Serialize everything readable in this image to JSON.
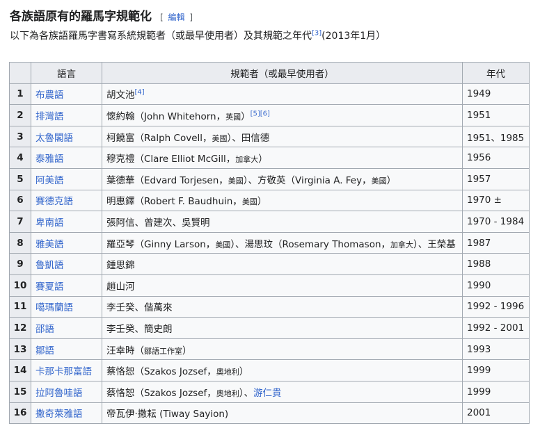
{
  "heading": {
    "title": "各族語原有的羅馬字規範化",
    "edit_open": "[",
    "edit_label": "編輯",
    "edit_close": "]"
  },
  "intro": {
    "text_before": "以下為各族語羅馬字書寫系統規範者（或最早使用者）及其規範之年代",
    "ref": "[3]",
    "text_after": "(2013年1月）"
  },
  "table": {
    "headers": {
      "num": "",
      "language": "語言",
      "standardizer": "規範者（或最早使用者）",
      "year": "年代"
    },
    "rows": [
      {
        "num": "1",
        "language": "布農語",
        "standardizer": [
          {
            "t": "胡文池"
          },
          {
            "ref": "[4]"
          }
        ],
        "year": "1949"
      },
      {
        "num": "2",
        "language": "排灣語",
        "standardizer": [
          {
            "t": "懷約翰（John Whitehorn，"
          },
          {
            "s": "英國"
          },
          {
            "t": "）"
          },
          {
            "ref": "[5]"
          },
          {
            "ref": "[6]"
          }
        ],
        "year": "1951"
      },
      {
        "num": "3",
        "language": "太魯閣語",
        "standardizer": [
          {
            "t": "柯饒富（Ralph Covell，"
          },
          {
            "s": "美國"
          },
          {
            "t": "）、田信德"
          }
        ],
        "year": "1951、1985"
      },
      {
        "num": "4",
        "language": "泰雅語",
        "standardizer": [
          {
            "t": "穆克禮（Clare Elliot McGill，"
          },
          {
            "s": "加拿大"
          },
          {
            "t": "）"
          }
        ],
        "year": "1956"
      },
      {
        "num": "5",
        "language": "阿美語",
        "standardizer": [
          {
            "t": "葉德華（Edvard Torjesen，"
          },
          {
            "s": "美國"
          },
          {
            "t": "）、方敬英（Virginia A. Fey，"
          },
          {
            "s": "美國"
          },
          {
            "t": "）"
          }
        ],
        "year": "1957"
      },
      {
        "num": "6",
        "language": "賽德克語",
        "standardizer": [
          {
            "t": "明惠鐸（Robert F. Baudhuin，"
          },
          {
            "s": "美國"
          },
          {
            "t": "）"
          }
        ],
        "year": "1970 ±"
      },
      {
        "num": "7",
        "language": "卑南語",
        "standardizer": [
          {
            "t": "張阿信、曾建次、吳賢明"
          }
        ],
        "year": "1970 - 1984"
      },
      {
        "num": "8",
        "language": "雅美語",
        "standardizer": [
          {
            "t": "羅亞琴（Ginny Larson，"
          },
          {
            "s": "美國"
          },
          {
            "t": "）、湯思玟（Rosemary Thomason，"
          },
          {
            "s": "加拿大"
          },
          {
            "t": "）、王榮基"
          }
        ],
        "year": "1987"
      },
      {
        "num": "9",
        "language": "魯凱語",
        "standardizer": [
          {
            "t": "鍾思錦"
          }
        ],
        "year": "1988"
      },
      {
        "num": "10",
        "language": "賽夏語",
        "standardizer": [
          {
            "t": "趙山河"
          }
        ],
        "year": "1990"
      },
      {
        "num": "11",
        "language": "噶瑪蘭語",
        "standardizer": [
          {
            "t": "李壬癸、偕萬來"
          }
        ],
        "year": "1992 - 1996"
      },
      {
        "num": "12",
        "language": "邵語",
        "standardizer": [
          {
            "t": "李壬癸、簡史朗"
          }
        ],
        "year": "1992 - 2001"
      },
      {
        "num": "13",
        "language": "鄒語",
        "standardizer": [
          {
            "t": "汪幸時（"
          },
          {
            "s": "鄒語工作室"
          },
          {
            "t": "）"
          }
        ],
        "year": "1993"
      },
      {
        "num": "14",
        "language": "卡那卡那富語",
        "standardizer": [
          {
            "t": "蔡恪恕（Szakos Jozsef，"
          },
          {
            "s": "奧地利"
          },
          {
            "t": "）"
          }
        ],
        "year": "1999"
      },
      {
        "num": "15",
        "language": "拉阿魯哇語",
        "standardizer": [
          {
            "t": "蔡恪恕（Szakos Jozsef，"
          },
          {
            "s": "奧地利"
          },
          {
            "t": "）、"
          },
          {
            "link": "游仁貴"
          }
        ],
        "year": "1999"
      },
      {
        "num": "16",
        "language": "撒奇萊雅語",
        "standardizer": [
          {
            "t": "帝瓦伊·撒耘 (Tiway Sayion)"
          }
        ],
        "year": "2001"
      }
    ]
  },
  "colors": {
    "link": "#3366cc",
    "text": "#202122",
    "header_bg": "#eaecf0",
    "cell_bg": "#f8f9fa",
    "border": "#a2a9b1"
  }
}
